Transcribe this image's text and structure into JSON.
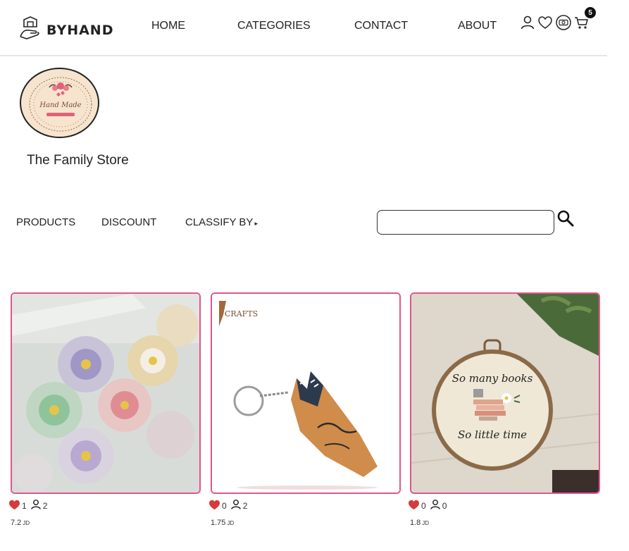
{
  "brand": {
    "name": "BYHAND",
    "logo_icon": "hand-logo-icon"
  },
  "nav": [
    {
      "label": "HOME"
    },
    {
      "label": "CATEGORIES"
    },
    {
      "label": "CONTACT"
    },
    {
      "label": "ABOUT"
    }
  ],
  "header_icons": [
    "user-icon",
    "heart-icon",
    "money-icon",
    "cart-icon"
  ],
  "cart": {
    "count": "5"
  },
  "store": {
    "name": "The Family Store",
    "logo_text": "Hand Made"
  },
  "filters": {
    "products": "PRODUCTS",
    "discount": "DISCOUNT",
    "classify": "CLASSIFY BY",
    "classify_caret": "▸"
  },
  "search": {
    "placeholder": "",
    "value": ""
  },
  "products": [
    {
      "likes": "1",
      "followers": "2",
      "price": "7.2",
      "currency": "JD",
      "image": "flower-jars-photo"
    },
    {
      "likes": "0",
      "followers": "2",
      "price": "1.75",
      "currency": "JD",
      "image": "wooden-keychain-photo",
      "image_brand": "CRAFTS"
    },
    {
      "likes": "0",
      "followers": "0",
      "price": "1.8",
      "currency": "JD",
      "image": "embroidery-hoop-photo",
      "hoop_line1": "So many books",
      "hoop_line2": "So little time"
    }
  ],
  "colors": {
    "accent": "#e0578a",
    "heart": "#d63a3a",
    "text": "#222222"
  }
}
